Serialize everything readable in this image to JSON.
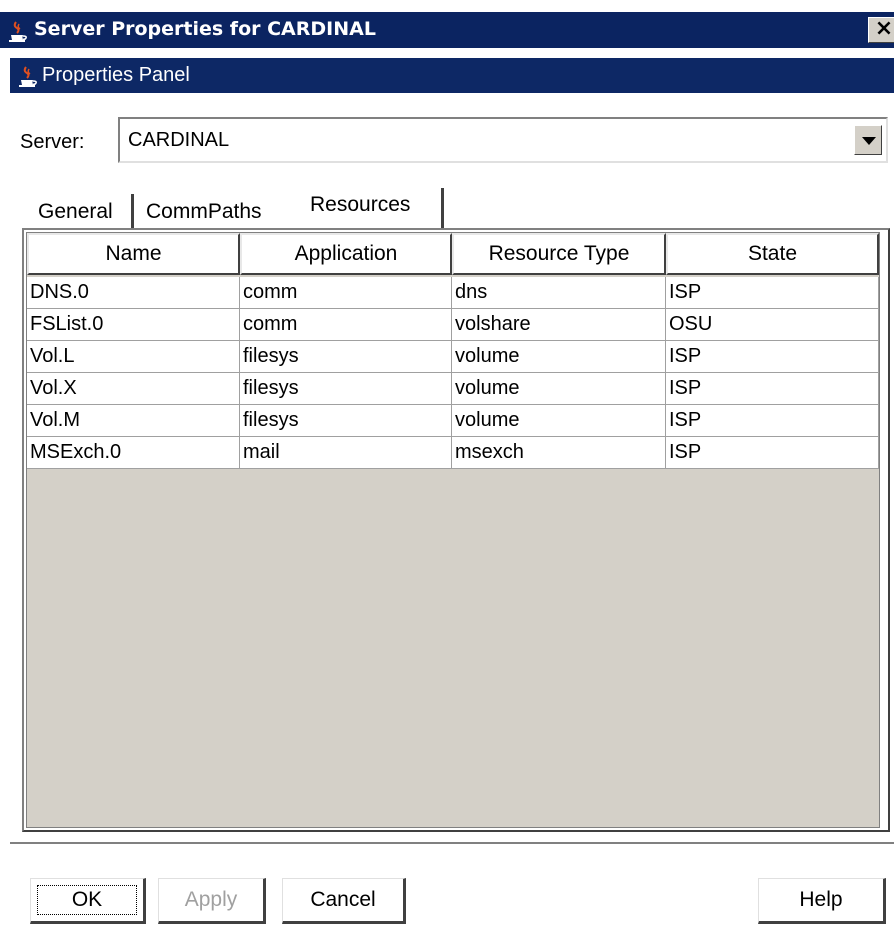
{
  "window": {
    "title": "Server Properties for CARDINAL",
    "close_label": "×"
  },
  "panel": {
    "title": "Properties Panel"
  },
  "server": {
    "label": "Server:",
    "value": "CARDINAL"
  },
  "tabs": [
    {
      "label": "General",
      "selected": false
    },
    {
      "label": "CommPaths",
      "selected": false
    },
    {
      "label": "Resources",
      "selected": true
    }
  ],
  "table": {
    "columns": [
      "Name",
      "Application",
      "Resource Type",
      "State"
    ],
    "rows": [
      [
        "DNS.0",
        "comm",
        "dns",
        "ISP"
      ],
      [
        "FSList.0",
        "comm",
        "volshare",
        "OSU"
      ],
      [
        "Vol.L",
        "filesys",
        "volume",
        "ISP"
      ],
      [
        "Vol.X",
        "filesys",
        "volume",
        "ISP"
      ],
      [
        "Vol.M",
        "filesys",
        "volume",
        "ISP"
      ],
      [
        "MSExch.0",
        "mail",
        "msexch",
        "ISP"
      ]
    ]
  },
  "buttons": {
    "ok": "OK",
    "apply": "Apply",
    "cancel": "Cancel",
    "help": "Help"
  },
  "colors": {
    "titlebar": "#0b2461",
    "panel_bg": "#d4d0c8",
    "disabled_text": "#a0a0a0"
  },
  "icons": {
    "window_icon": "java-cup-icon",
    "panel_icon": "java-cup-icon",
    "combo_arrow": "triangle-down-icon"
  }
}
